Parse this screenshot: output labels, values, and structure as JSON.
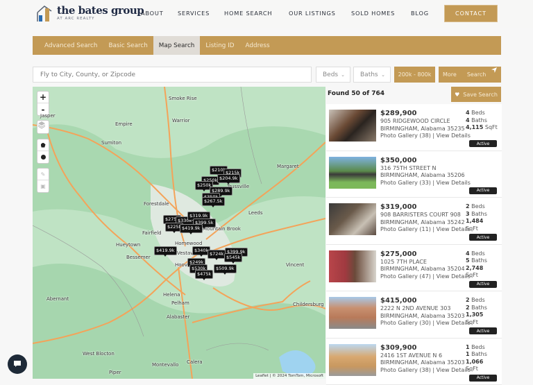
{
  "header": {
    "logo_title": "the bates group",
    "logo_subtitle": "AT ARC REALTY",
    "nav": [
      "ABOUT",
      "SERVICES",
      "HOME SEARCH",
      "OUR LISTINGS",
      "SOLD HOMES",
      "BLOG"
    ],
    "contact_label": "CONTACT"
  },
  "tabs": [
    {
      "label": "Advanced Search",
      "active": false
    },
    {
      "label": "Basic Search",
      "active": false
    },
    {
      "label": "Map Search",
      "active": true
    },
    {
      "label": "Listing ID",
      "active": false
    },
    {
      "label": "Address",
      "active": false
    }
  ],
  "search": {
    "placeholder": "Fly to City, County, or Zipcode",
    "beds_label": "Beds",
    "baths_label": "Baths",
    "price_range": "200k - 800k",
    "more_label": "More",
    "search_label": "Search"
  },
  "colors": {
    "accent": "#c39a55",
    "dark": "#1e2a38",
    "map_green": "#bfe3c4"
  },
  "map": {
    "cities": [
      "Smoke Rise",
      "Warrior",
      "Jasper",
      "Empire",
      "Sumiton",
      "Margaret",
      "Forestdale",
      "Trussville",
      "Leeds",
      "Fairfield",
      "Mountain Brook",
      "Hueytown",
      "Homewood",
      "Vestavia Hills",
      "Bessemer",
      "Hoover",
      "Vincent",
      "Abernant",
      "Helena",
      "Pelham",
      "Alabaster",
      "Childersburg",
      "West Blocton",
      "Piper",
      "Montevallo",
      "Calera"
    ],
    "price_pins": [
      "$210k",
      "$215k",
      "$250k",
      "$204.9k",
      "$250k",
      "$289.9k",
      "$350k",
      "$267.5k",
      "$275k",
      "$330k",
      "$319.9k",
      "$399.5k",
      "$225k",
      "$419.9k",
      "$419.9k",
      "$340k",
      "$724k",
      "$399.9k",
      "$545k",
      "$249k",
      "$530k",
      "$509.9k",
      "$475k"
    ],
    "attribution": "Leaflet | © 2024 TomTom, Microsoft",
    "zoom_in": "+",
    "zoom_out": "-"
  },
  "results": {
    "found_text": "Found 50 of 764",
    "save_label": "Save Search",
    "listings": [
      {
        "price": "$289,900",
        "street": "905 RIDGEWOOD CIRCLE",
        "city": "BIRMINGHAM, Alabama 35235",
        "links": "Photo Gallery (38) | View Details",
        "beds": "4",
        "baths": "4",
        "sqft": "4,115",
        "status": "Active"
      },
      {
        "price": "$350,000",
        "street": "316 75TH STREET N",
        "city": "BIRMINGHAM, Alabama 35206",
        "links": "Photo Gallery (33) | View Details",
        "beds": "",
        "baths": "",
        "sqft": "",
        "status": "Active"
      },
      {
        "price": "$319,000",
        "street": "908 BARRISTERS COURT 908",
        "city": "BIRMINGHAM, Alabama 35242",
        "links": "Photo Gallery (11) | View Details",
        "beds": "2",
        "baths": "3",
        "sqft": "1,484",
        "status": "Active"
      },
      {
        "price": "$275,000",
        "street": "1025 7TH PLACE",
        "city": "BIRMINGHAM, Alabama 35204",
        "links": "Photo Gallery (47) | View Details",
        "beds": "4",
        "baths": "5",
        "sqft": "2,748",
        "status": "Active"
      },
      {
        "price": "$415,000",
        "street": "2222 N 2ND AVENUE 303",
        "city": "BIRMINGHAM, Alabama 35203",
        "links": "Photo Gallery (30) | View Details",
        "beds": "2",
        "baths": "2",
        "sqft": "1,305",
        "status": "Active"
      },
      {
        "price": "$309,900",
        "street": "2416 1ST AVENUE N 6",
        "city": "BIRMINGHAM, Alabama 35203",
        "links": "Photo Gallery (38) | View Details",
        "beds": "1",
        "baths": "1",
        "sqft": "1,066",
        "status": "Active"
      }
    ],
    "beds_unit": "Beds",
    "baths_unit": "Baths",
    "sqft_unit": "SqFt"
  }
}
